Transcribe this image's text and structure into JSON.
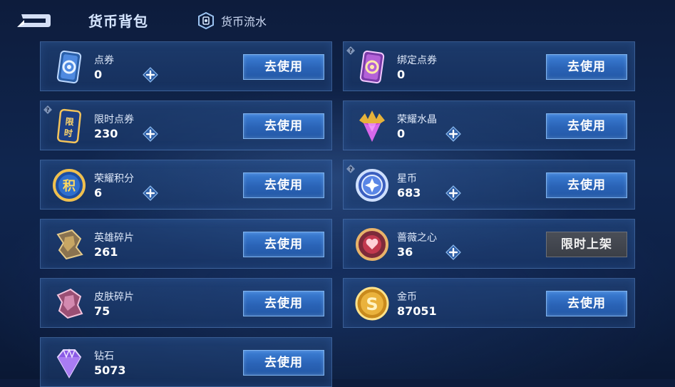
{
  "header": {
    "title": "货币背包",
    "flow_label": "货币流水"
  },
  "colors": {
    "accent_button": "#2f6fc6",
    "disabled_button": "#42464e",
    "background": "#10264f"
  },
  "items": [
    {
      "name": "点券",
      "value": "0",
      "icon": "coupon-ticket-icon",
      "action": "去使用",
      "has_plus": true,
      "has_help": false
    },
    {
      "name": "绑定点券",
      "value": "0",
      "icon": "bound-coupon-icon",
      "action": "去使用",
      "has_plus": false,
      "has_help": true
    },
    {
      "name": "限时点券",
      "value": "230",
      "icon": "limited-coupon-icon",
      "action": "去使用",
      "has_plus": true,
      "has_help": true
    },
    {
      "name": "荣耀水晶",
      "value": "0",
      "icon": "glory-crystal-icon",
      "action": "去使用",
      "has_plus": true,
      "has_help": false
    },
    {
      "name": "荣耀积分",
      "value": "6",
      "icon": "glory-points-icon",
      "action": "去使用",
      "has_plus": true,
      "has_help": false
    },
    {
      "name": "星币",
      "value": "683",
      "icon": "star-coin-icon",
      "action": "去使用",
      "has_plus": true,
      "has_help": true
    },
    {
      "name": "英雄碎片",
      "value": "261",
      "icon": "hero-fragment-icon",
      "action": "去使用",
      "has_plus": false,
      "has_help": false
    },
    {
      "name": "蔷薇之心",
      "value": "36",
      "icon": "rose-heart-icon",
      "action": "限时上架",
      "action_disabled": true,
      "has_plus": true,
      "has_help": false
    },
    {
      "name": "皮肤碎片",
      "value": "75",
      "icon": "skin-fragment-icon",
      "action": "去使用",
      "has_plus": false,
      "has_help": false
    },
    {
      "name": "金币",
      "value": "87051",
      "icon": "gold-coin-icon",
      "action": "去使用",
      "has_plus": false,
      "has_help": false
    },
    {
      "name": "钻石",
      "value": "5073",
      "icon": "diamond-icon",
      "action": "去使用",
      "has_plus": false,
      "has_help": false
    }
  ]
}
